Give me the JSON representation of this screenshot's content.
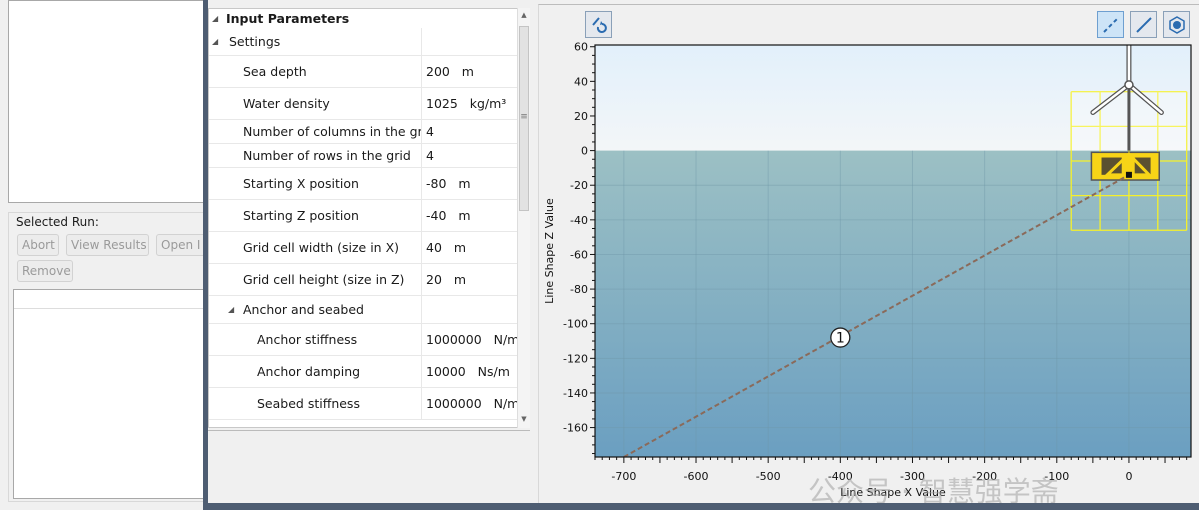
{
  "left_panel": {
    "selected_run_label": "Selected Run:",
    "buttons": {
      "abort": "Abort",
      "view_results": "View Results",
      "open": "Open I",
      "remove": "Remove"
    }
  },
  "property_grid": {
    "title": "Input Parameters",
    "rows": [
      {
        "kind": "category",
        "label": "Settings",
        "value": ""
      },
      {
        "kind": "prop",
        "label": "Sea depth",
        "value": "200   m"
      },
      {
        "kind": "prop",
        "label": "Water density",
        "value": "1025   kg/m³"
      },
      {
        "kind": "prop",
        "label": "Number of columns in the grid",
        "value": "4"
      },
      {
        "kind": "prop",
        "label": "Number of rows in the grid",
        "value": "4"
      },
      {
        "kind": "prop",
        "label": "Starting X position",
        "value": "-80   m"
      },
      {
        "kind": "prop",
        "label": "Starting Z position",
        "value": "-40   m"
      },
      {
        "kind": "prop",
        "label": "Grid cell width (size in X)",
        "value": "40   m"
      },
      {
        "kind": "prop",
        "label": "Grid cell height (size in Z)",
        "value": "20   m"
      },
      {
        "kind": "subcategory",
        "label": "Anchor and seabed",
        "value": ""
      },
      {
        "kind": "subprop",
        "label": "Anchor stiffness",
        "value": "1000000   N/m"
      },
      {
        "kind": "subprop",
        "label": "Anchor damping",
        "value": "10000   Ns/m"
      },
      {
        "kind": "subprop",
        "label": "Seabed stiffness",
        "value": "1000000   N/m"
      }
    ]
  },
  "toolbar": {
    "icons": [
      "reset-view-icon",
      "dashed-line-icon",
      "solid-line-icon",
      "export-icon"
    ],
    "active": "dashed-line-icon"
  },
  "chart_data": {
    "type": "line",
    "xlabel": "Line Shape X Value",
    "ylabel": "Line Shape Z Value",
    "xlim": [
      -740,
      86
    ],
    "ylim": [
      -177,
      61
    ],
    "xticks": [
      -700,
      -600,
      -500,
      -400,
      -300,
      -200,
      -100,
      0
    ],
    "yticks": [
      60,
      40,
      20,
      0,
      -20,
      -40,
      -60,
      -80,
      -100,
      -120,
      -140,
      -160
    ],
    "water_surface_z": 0,
    "series": [
      {
        "points": [
          [
            -700,
            -177
          ],
          [
            0,
            -14
          ]
        ],
        "style": "dashed",
        "color": "#8a6a5a",
        "label": "1",
        "label_at": [
          -400,
          -108
        ]
      }
    ],
    "structure_grid": {
      "x": [
        -80,
        -40,
        0,
        40,
        80
      ],
      "z": [
        34,
        14,
        -6,
        -26,
        -46
      ],
      "color": "#f5f02a"
    },
    "colors": {
      "sky_top": "#e2f0fb",
      "sky_bottom": "#f3f6f8",
      "water_top": "#9cc0c4",
      "water_bottom": "#6b9fc1",
      "platform": "#f7d417"
    }
  },
  "watermark": "公众号 · 智慧强学斋"
}
